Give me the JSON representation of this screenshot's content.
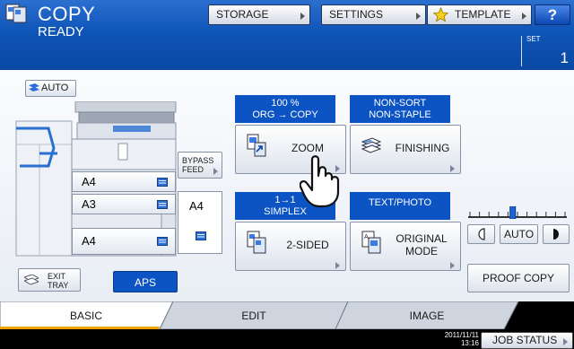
{
  "header": {
    "title": "COPY",
    "status": "READY",
    "buttons": {
      "storage": "STORAGE",
      "settings": "SETTINGS",
      "template": "TEMPLATE",
      "help": "?"
    },
    "set_label": "SET",
    "copy_count": "1",
    "colors": {
      "bar": "#0f55b8",
      "accent": "#0c53c4"
    }
  },
  "left_panel": {
    "auto_badge": "AUTO",
    "trays": [
      {
        "size": "A4",
        "icon": "paper-orientation-icon"
      },
      {
        "size": "A3",
        "icon": "paper-orientation-icon"
      },
      {
        "size": "A4",
        "icon": "paper-orientation-icon"
      }
    ],
    "bypass_feed": {
      "line1": "BYPASS",
      "line2": "FEED"
    },
    "bypass_size": "A4",
    "exit_tray": {
      "line1": "EXIT",
      "line2": "TRAY"
    },
    "aps": "APS"
  },
  "functions": {
    "zoom": {
      "header_line1": "100 %",
      "header_line2": "ORG → COPY",
      "label": "ZOOM",
      "icon": "zoom-icon"
    },
    "finishing": {
      "header_line1": "NON-SORT",
      "header_line2": "NON-STAPLE",
      "label": "FINISHING",
      "icon": "paper-stack-icon"
    },
    "two_sided": {
      "header_line1": "1→1",
      "header_line2": "SIMPLEX",
      "label": "2-SIDED",
      "icon": "duplex-icon"
    },
    "original_mode": {
      "header_line1": "TEXT/PHOTO",
      "label_line1": "ORIGINAL",
      "label_line2": "MODE",
      "icon": "original-mode-icon"
    }
  },
  "density": {
    "auto": "AUTO",
    "level_fraction": 0.45
  },
  "proof_copy": "PROOF COPY",
  "tabs": [
    {
      "label": "BASIC",
      "active": true
    },
    {
      "label": "EDIT",
      "active": false
    },
    {
      "label": "IMAGE",
      "active": false
    }
  ],
  "footer": {
    "date": "2011/11/11",
    "time": "13:16",
    "job_status": "JOB STATUS"
  }
}
